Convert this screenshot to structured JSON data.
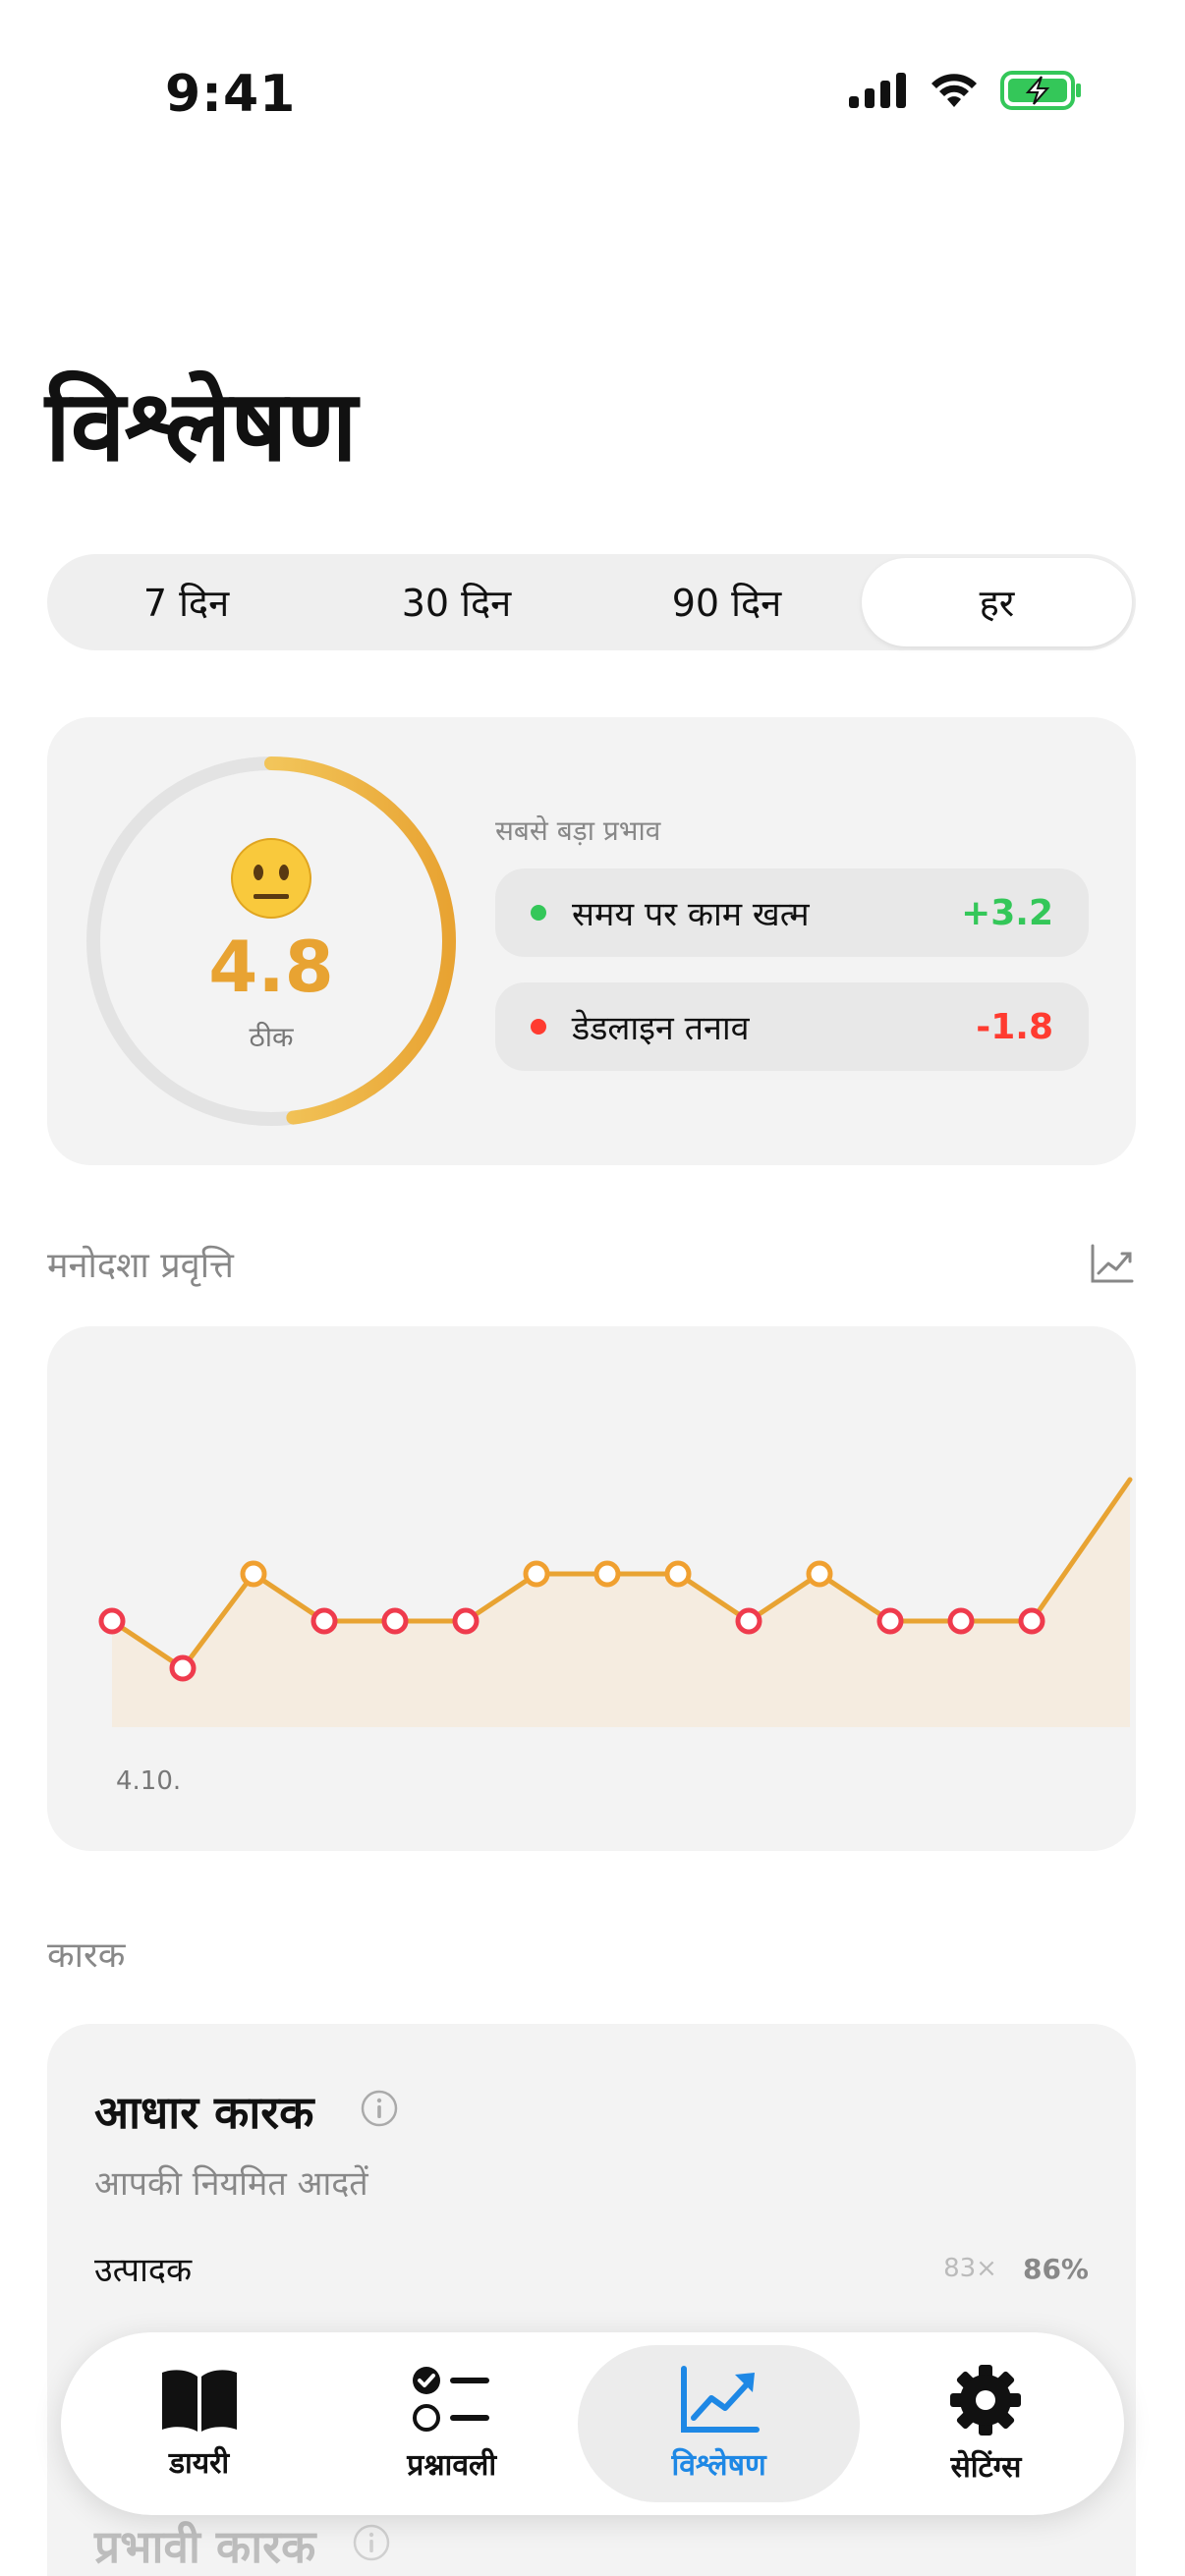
{
  "status_bar": {
    "time": "9:41"
  },
  "page": {
    "title": "विश्लेषण"
  },
  "range_tabs": [
    {
      "label": "7 दिन",
      "active": false
    },
    {
      "label": "30 दिन",
      "active": false
    },
    {
      "label": "90 दिन",
      "active": false
    },
    {
      "label": "हर",
      "active": true
    }
  ],
  "score": {
    "emoji": "neutral-face",
    "value": "4.8",
    "label": "ठीक",
    "progress": 0.48,
    "ring_color": "#e8a332"
  },
  "impact": {
    "title": "सबसे बड़ा प्रभाव",
    "items": [
      {
        "label": "समय पर काम खत्म",
        "value": "+3.2",
        "color": "#34c759"
      },
      {
        "label": "डेडलाइन तनाव",
        "value": "-1.8",
        "color": "#ff3b30"
      }
    ]
  },
  "trend": {
    "title": "मनोदशा प्रवृत्ति",
    "icon": "chart-line-icon"
  },
  "chart_data": {
    "type": "line",
    "x_start_label": "4.10.",
    "values": [
      4.5,
      4.1,
      4.9,
      4.5,
      4.5,
      4.5,
      4.9,
      4.9,
      4.9,
      4.5,
      4.9,
      4.5,
      4.5,
      4.5,
      5.7
    ],
    "point_colors": [
      "red",
      "red",
      "orange",
      "red",
      "red",
      "red",
      "orange",
      "orange",
      "orange",
      "red",
      "orange",
      "red",
      "red",
      "red",
      "none"
    ],
    "line_color": "#e8a332",
    "colors": {
      "red": "#ef3b4d",
      "orange": "#f0a030"
    }
  },
  "factors": {
    "section_label": "कारक",
    "base_title": "आधार कारक",
    "base_subtitle": "आपकी नियमित आदतें",
    "rows": [
      {
        "name": "उत्पादक",
        "count": "83×",
        "pct": "86%"
      }
    ],
    "impact_title": "प्रभावी कारक"
  },
  "tabbar": [
    {
      "label": "डायरी",
      "icon": "book-icon",
      "active": false
    },
    {
      "label": "प्रश्नावली",
      "icon": "checklist-icon",
      "active": false
    },
    {
      "label": "विश्लेषण",
      "icon": "chart-line-icon",
      "active": true
    },
    {
      "label": "सेटिंग्स",
      "icon": "gear-icon",
      "active": false
    }
  ]
}
